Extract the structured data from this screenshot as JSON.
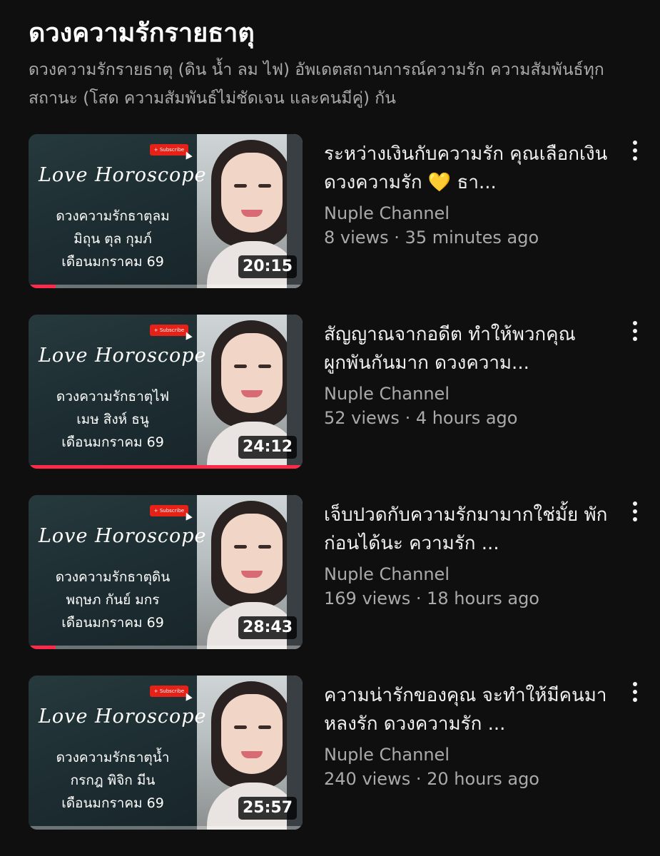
{
  "playlist": {
    "title": "ดวงความรักรายธาตุ",
    "description": "ดวงความรักรายธาตุ (ดิน น้ำ ลม ไฟ) อัพเดตสถานการณ์ความรัก ความสัมพันธ์ทุกสถานะ (โสด ความสัมพันธ์ไม่ชัดเจน และคนมีคู่) กัน"
  },
  "colors": {
    "background": "#0f0f0f",
    "progress": "#ff2a4a",
    "subscribe": "#e62117"
  },
  "videos": [
    {
      "title": "ระหว่างเงินกับความรัก คุณเลือกเงิน ดวงความรัก 💛 ธา...",
      "channel": "Nuple Channel",
      "meta": "8 views · 35 minutes ago",
      "duration": "20:15",
      "progress": 0.1,
      "thumb": {
        "script": "Love Horoscope",
        "subscribe": "+ Subscribe",
        "line1": "ดวงความรักธาตุลม",
        "line2": "มิถุน ตุล กุมภ์",
        "line3": "เดือนมกราคม 69"
      }
    },
    {
      "title": "สัญญาณจากอดีต ทำให้พวกคุณผูกพันกันมาก ดวงความ...",
      "channel": "Nuple Channel",
      "meta": "52 views · 4 hours ago",
      "duration": "24:12",
      "progress": 1.0,
      "thumb": {
        "script": "Love Horoscope",
        "subscribe": "+ Subscribe",
        "line1": "ดวงความรักธาตุไฟ",
        "line2": "เมษ สิงห์ ธนู",
        "line3": "เดือนมกราคม 69"
      }
    },
    {
      "title": "เจ็บปวดกับความรักมามากใช่มั้ย พักก่อนได้นะ ความรัก ...",
      "channel": "Nuple Channel",
      "meta": "169 views · 18 hours ago",
      "duration": "28:43",
      "progress": 0.1,
      "thumb": {
        "script": "Love Horoscope",
        "subscribe": "+ Subscribe",
        "line1": "ดวงความรักธาตุดิน",
        "line2": "พฤษภ กันย์ มกร",
        "line3": "เดือนมกราคม 69"
      }
    },
    {
      "title": "ความน่ารักของคุณ จะทำให้มีคนมาหลงรัก ดวงความรัก ...",
      "channel": "Nuple Channel",
      "meta": "240 views · 20 hours ago",
      "duration": "25:57",
      "progress": 0,
      "thumb": {
        "script": "Love Horoscope",
        "subscribe": "+ Subscribe",
        "line1": "ดวงความรักธาตุน้ำ",
        "line2": "กรกฎ พิจิก มีน",
        "line3": "เดือนมกราคม 69"
      }
    }
  ]
}
